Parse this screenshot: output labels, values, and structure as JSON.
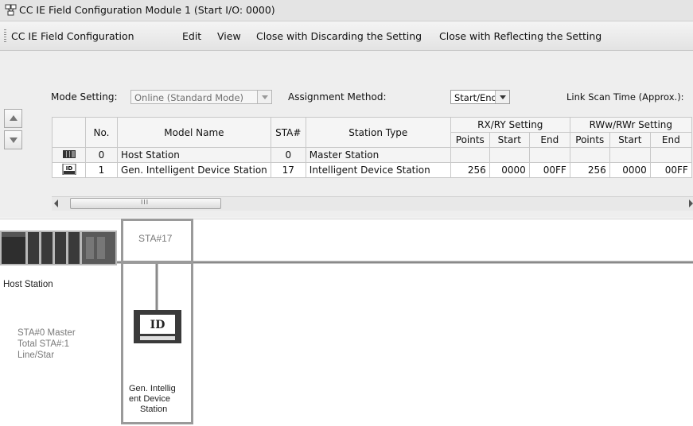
{
  "window": {
    "title": "CC IE Field Configuration Module 1 (Start I/O: 0000)"
  },
  "menu": [
    {
      "label": "CC IE Field Configuration"
    },
    {
      "label": "Edit"
    },
    {
      "label": "View"
    },
    {
      "label": "Close with Discarding the Setting"
    },
    {
      "label": "Close with Reflecting the Setting"
    }
  ],
  "settings": {
    "mode_label": "Mode Setting:",
    "mode_value": "Online (Standard Mode)",
    "assignment_label": "Assignment Method:",
    "assignment_value": "Start/End",
    "link_scan_label": "Link Scan Time (Approx.):"
  },
  "table": {
    "headers": {
      "no": "No.",
      "model": "Model Name",
      "sta": "STA#",
      "type": "Station Type",
      "rx_group": "RX/RY Setting",
      "rw_group": "RWw/RWr Setting",
      "points": "Points",
      "start": "Start",
      "end": "End"
    },
    "rows": [
      {
        "no": "0",
        "model": "Host Station",
        "sta": "0",
        "type": "Master Station",
        "rx_points": "",
        "rx_start": "",
        "rx_end": "",
        "rw_points": "",
        "rw_start": "",
        "rw_end": "",
        "icon": "host-station-icon"
      },
      {
        "no": "1",
        "model": "Gen. Intelligent Device Station",
        "sta": "17",
        "type": "Intelligent Device Station",
        "rx_points": "256",
        "rx_start": "0000",
        "rx_end": "00FF",
        "rw_points": "256",
        "rw_start": "0000",
        "rw_end": "00FF",
        "icon": "id-station-icon",
        "icon_text": "ID"
      }
    ]
  },
  "scrollbar": {
    "grip": "III"
  },
  "network": {
    "host_label": "Host Station",
    "host_info": [
      "STA#0  Master",
      "Total STA#:1",
      "Line/Star"
    ],
    "slave_sta": "STA#17",
    "slave_icon_text": "ID",
    "slave_name": [
      "Gen. Intellig",
      "ent Device",
      "Station"
    ]
  },
  "colors": {
    "accent_line": "#8a8a8a",
    "device_box": "#3a3a3a"
  }
}
